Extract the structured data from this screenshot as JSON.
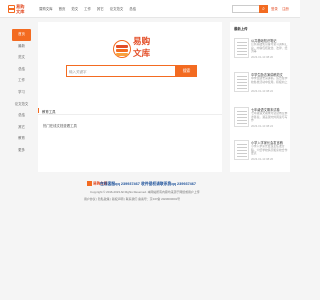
{
  "brand": {
    "line1": "易购",
    "line2": "文库",
    "accent": "#f36b21",
    "dark_accent": "#e34d26"
  },
  "nav": [
    "易购文库",
    "首页",
    "范文",
    "工作",
    "其它",
    "论文范文",
    "总结"
  ],
  "top_search": {
    "placeholder": "",
    "button_icon": "search-icon"
  },
  "top_links": [
    "登录",
    "注册"
  ],
  "sidebar": [
    "首页",
    "最新",
    "范文",
    "总结",
    "工作",
    "学习",
    "论文范文",
    "总结",
    "其它",
    "教育",
    "更多"
  ],
  "search": {
    "placeholder": "输入关键字",
    "button": "搜索"
  },
  "section": {
    "title": "教育工具",
    "text": "热门在线文档查看工具"
  },
  "right_panel": {
    "title": "最新上传",
    "items": [
      {
        "title": "公共基础知识笔记",
        "desc": "公共基础知识备考复习资料汇总，内容包括政治、法律、经济等",
        "date": "2023-01-10 08:20"
      },
      {
        "title": "中学生励志演讲稿范文",
        "desc": "中学生励志演讲稿，适合在学校各类活动中使用，积极向上",
        "date": "2023-01-10 08:22"
      },
      {
        "title": "七年级语文期末试卷",
        "desc": "七年级语文期末考试试卷及参考答案，涵盖课内外阅读与写作",
        "date": "2023-01-10 08:24"
      },
      {
        "title": "小学入学家长会发言稿",
        "desc": "小学入学家长会班主任发言稿，介绍学校情况和家校合作要点",
        "date": "2023-01-10 08:26"
      }
    ]
  },
  "footer": {
    "brand": "易购文库",
    "contact": "在线客服qq 239937467  收件侵权请联系我qq 239937467",
    "copyright": "Copyright © 2016-2023 All Rights Reserved. 本网站所有内容均来源于网络或用户上传",
    "record": "用户协议 | 隐私政策 | 版权声明 | 联系我们  备案号：京ICP备 2023000001号"
  }
}
